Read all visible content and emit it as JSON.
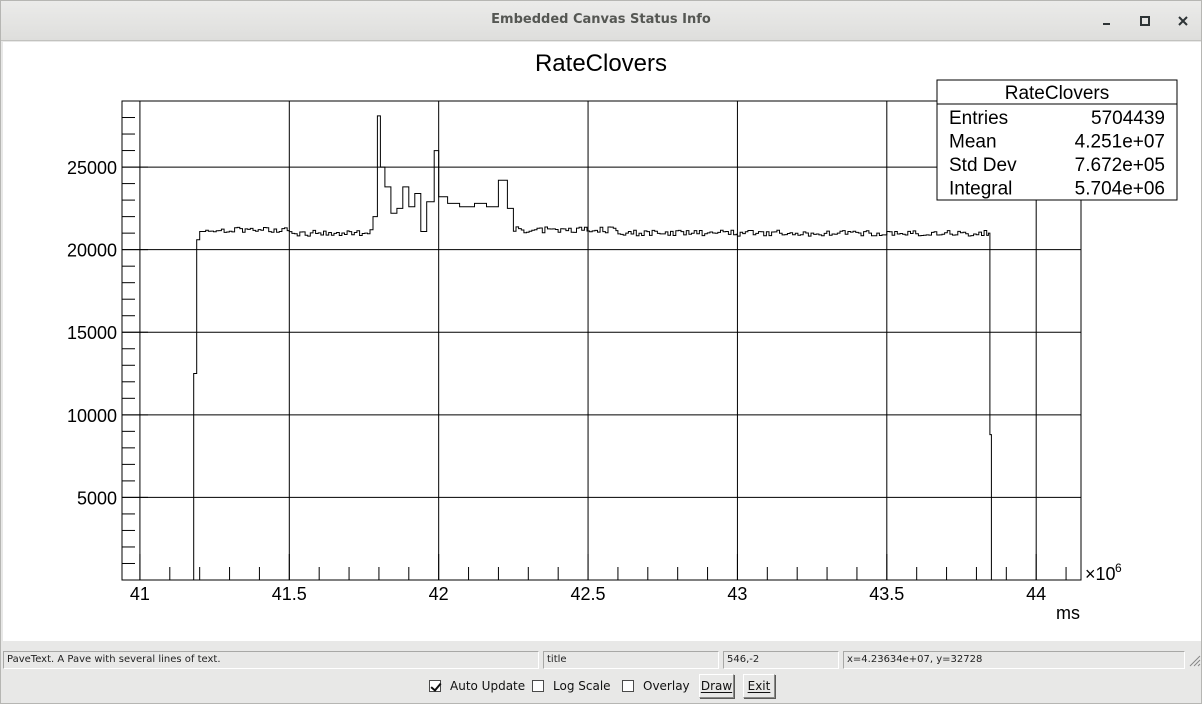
{
  "window": {
    "title": "Embedded Canvas Status Info"
  },
  "chart_data": {
    "type": "histogram",
    "title": "RateClovers",
    "xlabel": "ms",
    "ylabel": "",
    "x_exponent_label": "×10",
    "x_exponent": "6",
    "xlim": [
      40.94,
      44.15
    ],
    "ylim": [
      0,
      29000
    ],
    "x_ticks": [
      41,
      41.5,
      42,
      42.5,
      43,
      43.5,
      44
    ],
    "x_tick_labels": [
      "41",
      "41.5",
      "42",
      "42.5",
      "43",
      "43.5",
      "44"
    ],
    "y_ticks": [
      5000,
      10000,
      15000,
      20000,
      25000
    ],
    "y_tick_labels": [
      "5000",
      "10000",
      "15000",
      "20000",
      "25000"
    ],
    "grid": true,
    "bins": [
      {
        "x": 41.18,
        "y": 12500
      },
      {
        "x": 41.19,
        "y": 20600
      },
      {
        "x": 41.2,
        "y": 21100
      },
      {
        "x": 41.22,
        "y": 21200
      },
      {
        "x": 41.5,
        "y": 21000
      },
      {
        "x": 41.7,
        "y": 21000
      },
      {
        "x": 41.77,
        "y": 21200
      },
      {
        "x": 41.78,
        "y": 22000
      },
      {
        "x": 41.795,
        "y": 28100
      },
      {
        "x": 41.805,
        "y": 25000
      },
      {
        "x": 41.82,
        "y": 23800
      },
      {
        "x": 41.84,
        "y": 22200
      },
      {
        "x": 41.86,
        "y": 22500
      },
      {
        "x": 41.88,
        "y": 23800
      },
      {
        "x": 41.9,
        "y": 22600
      },
      {
        "x": 41.92,
        "y": 23400
      },
      {
        "x": 41.94,
        "y": 21100
      },
      {
        "x": 41.96,
        "y": 22900
      },
      {
        "x": 41.985,
        "y": 26000
      },
      {
        "x": 42.0,
        "y": 23200
      },
      {
        "x": 42.03,
        "y": 22800
      },
      {
        "x": 42.07,
        "y": 22600
      },
      {
        "x": 42.12,
        "y": 22800
      },
      {
        "x": 42.16,
        "y": 22600
      },
      {
        "x": 42.2,
        "y": 24200
      },
      {
        "x": 42.23,
        "y": 22500
      },
      {
        "x": 42.25,
        "y": 21200
      },
      {
        "x": 42.6,
        "y": 21000
      },
      {
        "x": 43.0,
        "y": 21000
      },
      {
        "x": 43.5,
        "y": 21000
      },
      {
        "x": 43.84,
        "y": 21000
      },
      {
        "x": 43.845,
        "y": 8800
      },
      {
        "x": 43.85,
        "y": 0
      }
    ],
    "stats_box": {
      "title": "RateClovers",
      "rows": [
        {
          "label": "Entries",
          "value": "5704439"
        },
        {
          "label": "Mean",
          "value": "4.251e+07"
        },
        {
          "label": "Std Dev",
          "value": "7.672e+05"
        },
        {
          "label": "Integral",
          "value": "5.704e+06"
        }
      ]
    }
  },
  "statusbar": {
    "object_info": "PaveText. A Pave with several lines of text.",
    "object_name": "title",
    "pixel_coords": "546,-2",
    "data_coords": "x=4.23634e+07, y=32728"
  },
  "controls": {
    "auto_update": {
      "label": "Auto Update",
      "checked": true
    },
    "log_scale": {
      "label": "Log Scale",
      "checked": false
    },
    "overlay": {
      "label": "Overlay",
      "checked": false
    },
    "draw_label": "Draw",
    "exit_label": "Exit"
  }
}
